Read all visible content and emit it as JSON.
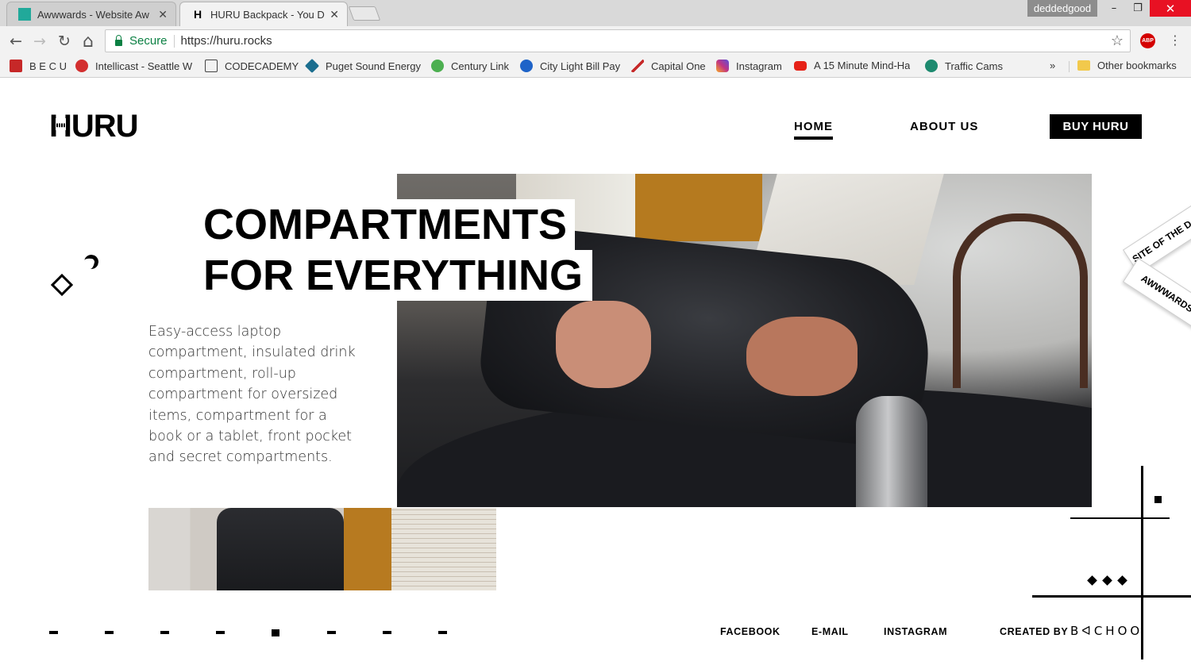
{
  "browser": {
    "tabs": [
      {
        "title": "Awwwards - Website Aw",
        "close": "✕"
      },
      {
        "title": "HURU Backpack - You D",
        "close": "✕"
      }
    ],
    "profile": "deddedgood",
    "window_controls": {
      "minimize": "–",
      "maximize": "❐",
      "close": "✕"
    },
    "nav": {
      "back": "←",
      "forward": "→",
      "reload": "↻",
      "home": "⌂"
    },
    "omnibox": {
      "secure_label": "Secure",
      "url": "https://huru.rocks",
      "star": "☆"
    },
    "abp_label": "ABP",
    "menu": "⋮",
    "bookmarks": [
      {
        "label": "B E C U",
        "icon": "becu-icon",
        "color": "#c62828"
      },
      {
        "label": "Intellicast - Seattle W",
        "icon": "intellicast-icon",
        "color": "#d32f2f"
      },
      {
        "label": "CODECADEMY",
        "icon": "codecademy-icon",
        "color": "#444444"
      },
      {
        "label": "Puget Sound Energy",
        "icon": "pse-icon",
        "color": "#1b6e8f"
      },
      {
        "label": "Century Link",
        "icon": "centurylink-icon",
        "color": "#4caf50"
      },
      {
        "label": "City Light Bill Pay",
        "icon": "globe-icon",
        "color": "#1e63c8"
      },
      {
        "label": "Capital One",
        "icon": "capitalone-icon",
        "color": "#c62828"
      },
      {
        "label": "Instagram",
        "icon": "instagram-icon",
        "color": "#c13584"
      },
      {
        "label": "A 15 Minute Mind-Ha",
        "icon": "youtube-icon",
        "color": "#e62117"
      },
      {
        "label": "Traffic Cams",
        "icon": "traffic-icon",
        "color": "#1d8a6f"
      }
    ],
    "more": "»",
    "other_bookmarks": "Other bookmarks"
  },
  "site": {
    "logo": "HURU",
    "nav": {
      "home": "HOME",
      "about": "ABOUT US",
      "buy": "BUY HURU"
    },
    "headline": {
      "line1": "COMPARTMENTS",
      "line2": "FOR EVERYTHING"
    },
    "description": "Easy-access laptop compartment, insulated drink compartment, roll-up compartment for oversized items, compartment for a book or a tablet, front pocket and secret compartments.",
    "badge": {
      "line1": "SITE OF THE DAY",
      "line2": "AWWWARDS"
    },
    "pager": {
      "count": 8,
      "active_index": 4
    },
    "footer": {
      "facebook": "FACEBOOK",
      "email": "E-MAIL",
      "instagram": "INSTAGRAM",
      "created_by": "CREATED BY",
      "agency": "BᐊCHOO"
    }
  }
}
